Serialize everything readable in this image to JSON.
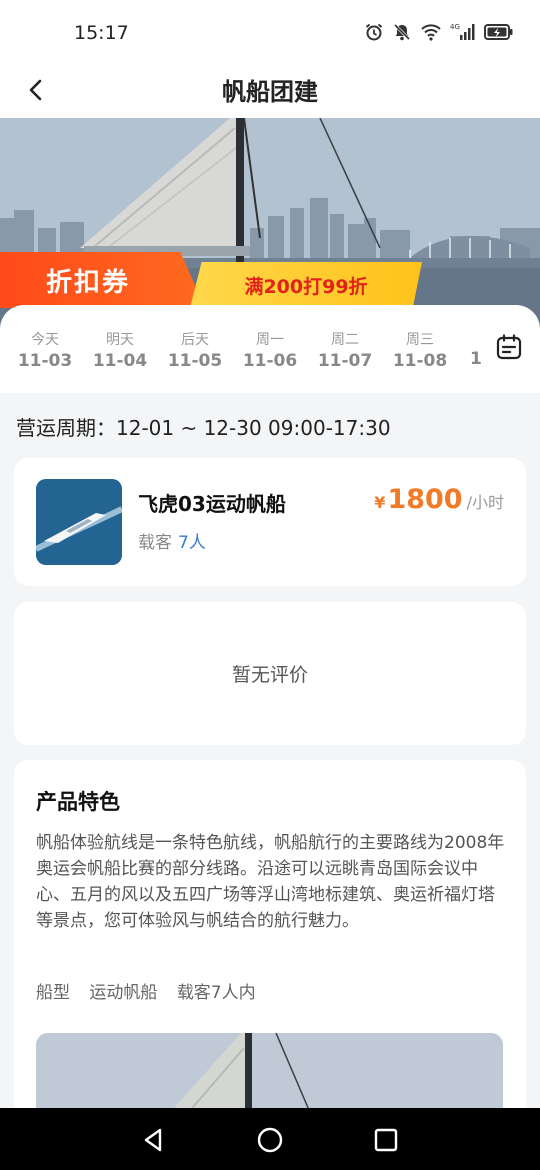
{
  "status_bar": {
    "time": "15:17",
    "icons": [
      "alarm-icon",
      "mute-icon",
      "wifi-icon",
      "signal-4g-icon",
      "battery-charging-icon"
    ],
    "network_label": "4G"
  },
  "header": {
    "title": "帆船团建",
    "back_icon": "back-arrow-icon"
  },
  "hero": {
    "coupon_label": "折扣券",
    "coupon_offer": "满200打99折",
    "colors": {
      "coupon_red": "#ff4a1a",
      "coupon_yellow": "#ffc21a",
      "offer_text": "#e2231a"
    }
  },
  "dates": [
    {
      "day": "今天",
      "date": "11-03"
    },
    {
      "day": "明天",
      "date": "11-04"
    },
    {
      "day": "后天",
      "date": "11-05"
    },
    {
      "day": "周一",
      "date": "11-06"
    },
    {
      "day": "周二",
      "date": "11-07"
    },
    {
      "day": "周三",
      "date": "11-08"
    }
  ],
  "date_overflow": "1",
  "calendar_icon": "calendar-icon",
  "operation_period": "营运周期：12-01 ~ 12-30  09:00-17:30",
  "product": {
    "name": "飞虎03运动帆船",
    "capacity_label": "载客",
    "capacity_value": "7人",
    "price_symbol": "¥",
    "price": "1800",
    "price_unit": "/小时",
    "accent_color": "#f07a25"
  },
  "reviews": {
    "empty_text": "暂无评价"
  },
  "features": {
    "title": "产品特色",
    "description": "帆船体验航线是一条特色航线，帆船航行的主要路线为2008年奥运会帆船比赛的部分线路。沿途可以远眺青岛国际会议中心、五月的风以及五四广场等浮山湾地标建筑、奥运祈福灯塔等景点，您可体验风与帆结合的航行魅力。",
    "boat_type_label": "船型",
    "boat_type_value": "运动帆船",
    "capacity_text": "载客7人内"
  },
  "system_nav": [
    "back-triangle-icon",
    "home-circle-icon",
    "recents-square-icon"
  ]
}
